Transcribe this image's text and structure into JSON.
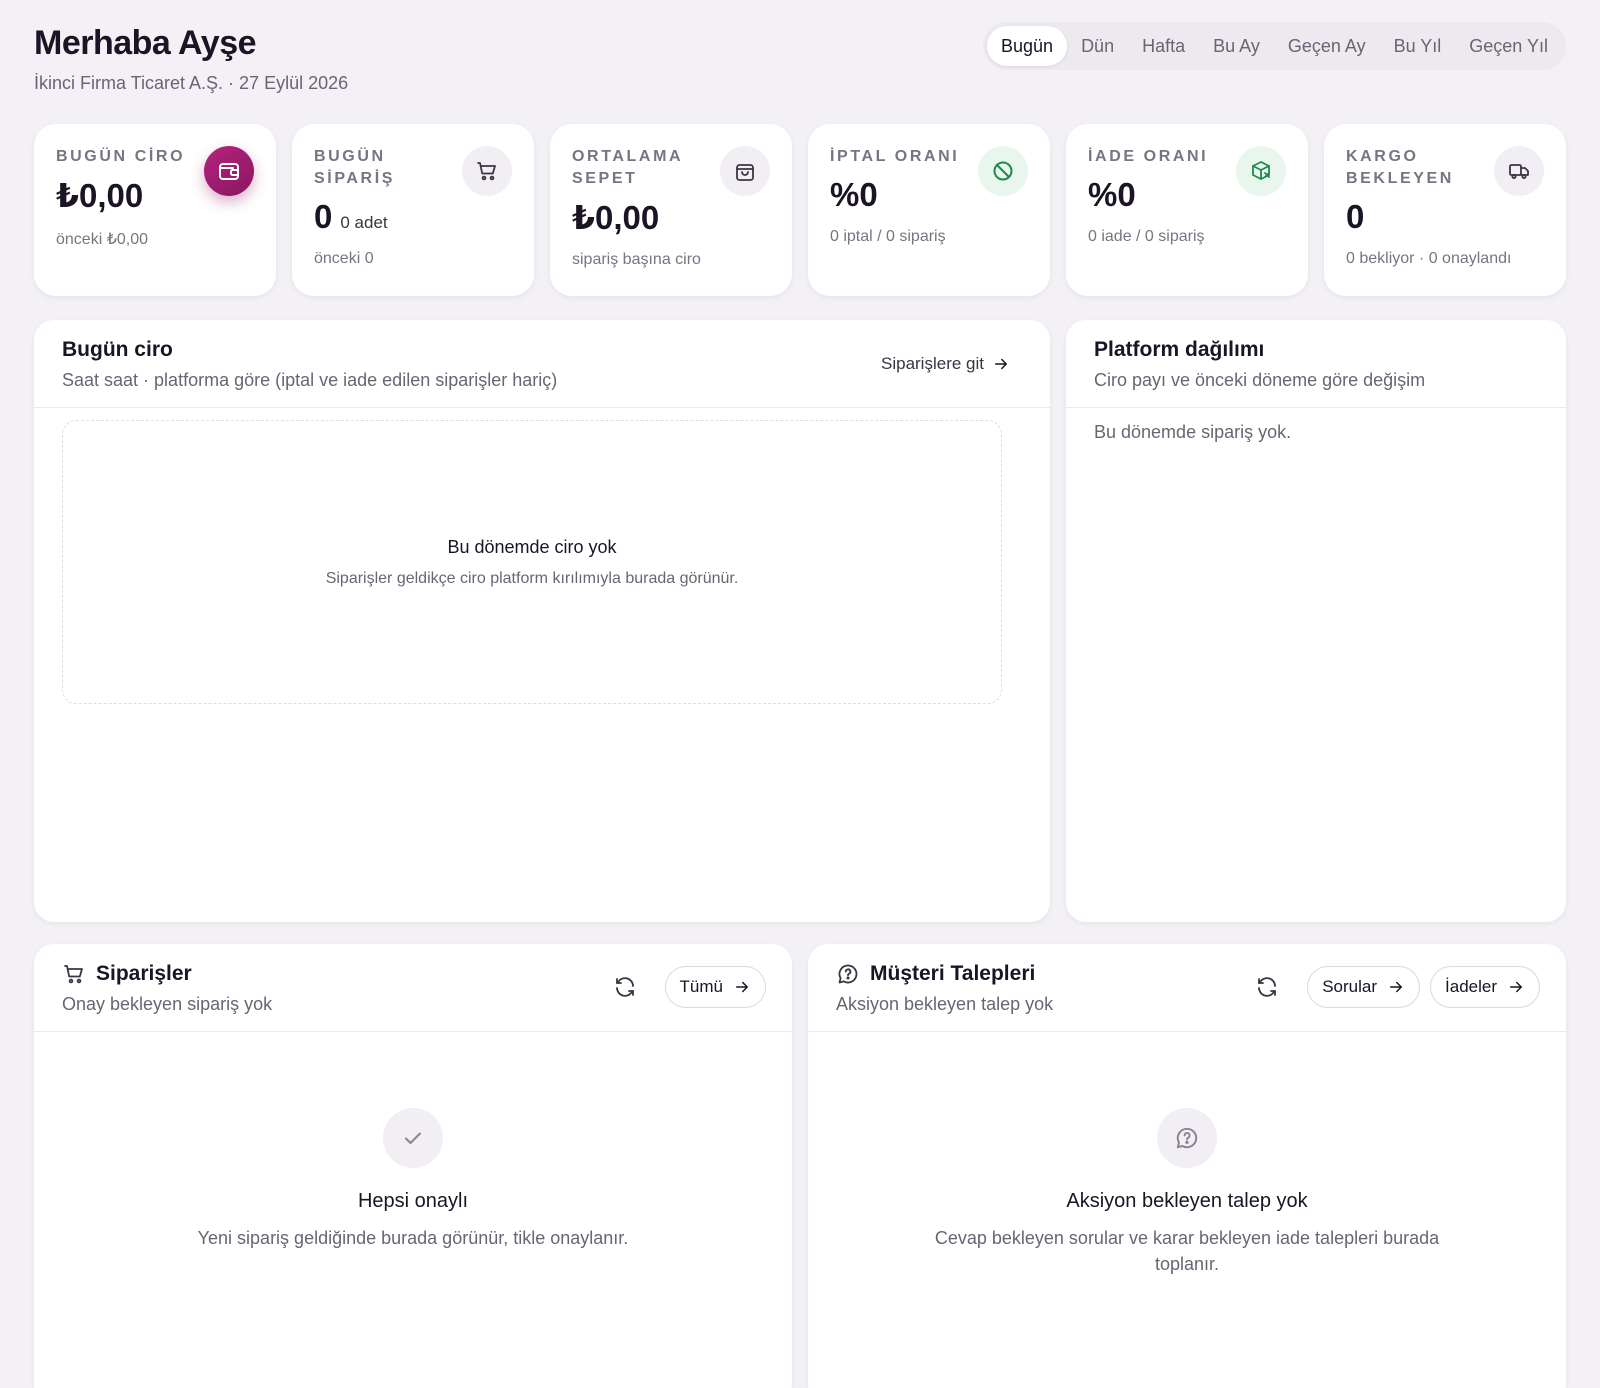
{
  "header": {
    "greeting": "Merhaba Ayşe",
    "subline": "İkinci Firma Ticaret A.Ş. · 27 Eylül 2026"
  },
  "periods": [
    {
      "label": "Bugün",
      "active": true
    },
    {
      "label": "Dün",
      "active": false
    },
    {
      "label": "Hafta",
      "active": false
    },
    {
      "label": "Bu Ay",
      "active": false
    },
    {
      "label": "Geçen Ay",
      "active": false
    },
    {
      "label": "Bu Yıl",
      "active": false
    },
    {
      "label": "Geçen Yıl",
      "active": false
    }
  ],
  "kpis": [
    {
      "label": "BUGÜN CİRO",
      "value": "₺0,00",
      "unit": "",
      "foot": "önceki ₺0,00",
      "icon": "wallet-icon"
    },
    {
      "label": "BUGÜN SİPARİŞ",
      "value": "0",
      "unit": "0 adet",
      "foot": "önceki 0",
      "icon": "cart-icon"
    },
    {
      "label": "ORTALAMA SEPET",
      "value": "₺0,00",
      "unit": "",
      "foot": "sipariş başına ciro",
      "icon": "bag-icon"
    },
    {
      "label": "İPTAL ORANI",
      "value": "%0",
      "unit": "",
      "foot": "0 iptal / 0 sipariş",
      "icon": "cancel-icon"
    },
    {
      "label": "İADE ORANI",
      "value": "%0",
      "unit": "",
      "foot": "0 iade / 0 sipariş",
      "icon": "package-return-icon"
    },
    {
      "label": "KARGO BEKLEYEN",
      "value": "0",
      "unit": "",
      "foot": "0 bekliyor · 0 onaylandı",
      "icon": "truck-icon"
    }
  ],
  "revenue_panel": {
    "title": "Bugün ciro",
    "subtitle": "Saat saat · platforma göre (iptal ve iade edilen siparişler hariç)",
    "link": "Siparişlere git",
    "empty_title": "Bu dönemde ciro yok",
    "empty_sub": "Siparişler geldikçe ciro platform kırılımıyla burada görünür."
  },
  "platform_panel": {
    "title": "Platform dağılımı",
    "subtitle": "Ciro payı ve önceki döneme göre değişim",
    "empty": "Bu dönemde sipariş yok."
  },
  "orders_panel": {
    "title": "Siparişler",
    "subtitle": "Onay bekleyen sipariş yok",
    "button_all": "Tümü",
    "empty_title": "Hepsi onaylı",
    "empty_sub": "Yeni sipariş geldiğinde burada görünür, tikle onaylanır."
  },
  "requests_panel": {
    "title": "Müşteri Talepleri",
    "subtitle": "Aksiyon bekleyen talep yok",
    "button_questions": "Sorular",
    "button_returns": "İadeler",
    "empty_title": "Aksiyon bekleyen talep yok",
    "empty_sub": "Cevap bekleyen sorular ve karar bekleyen iade talepleri burada toplanır."
  },
  "colors": {
    "accent": "#9b1c6e",
    "green_icon": "#1f8a4c"
  }
}
